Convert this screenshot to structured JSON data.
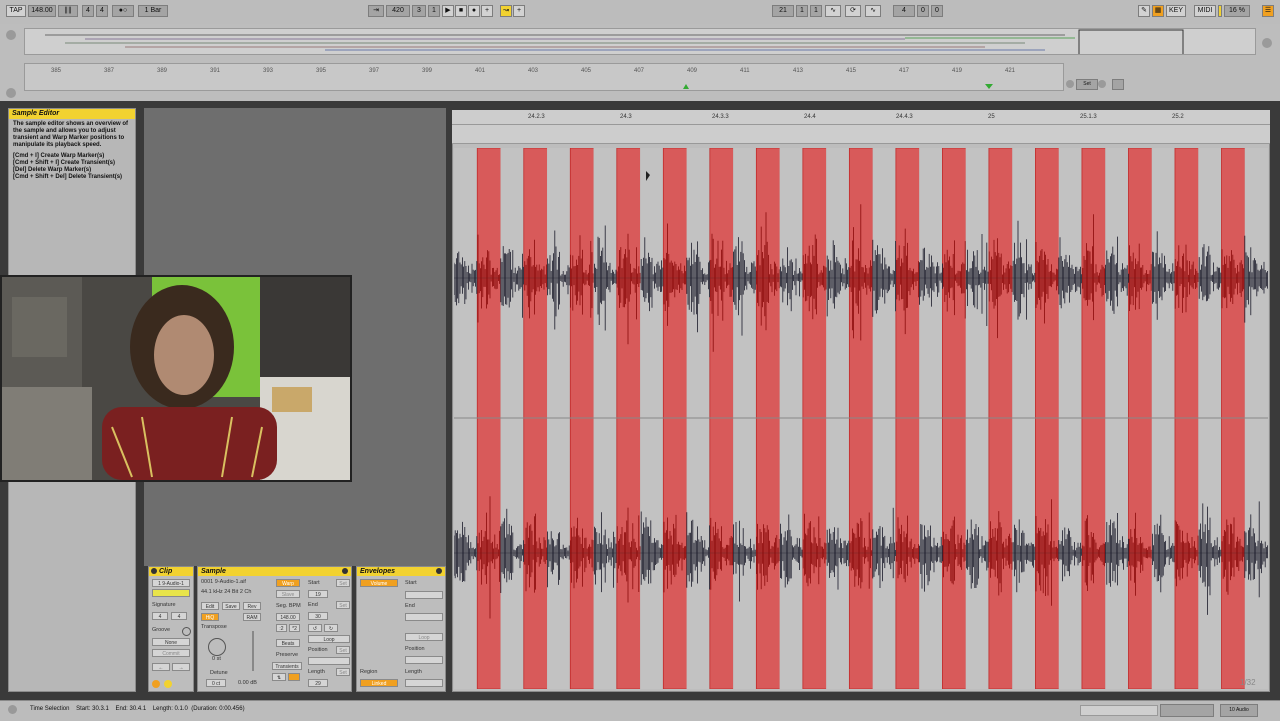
{
  "transport": {
    "tap": "TAP",
    "tempo": "148.00",
    "sig_num": "4",
    "sig_den": "4",
    "quantize": "1 Bar",
    "arr_pos_bar": "420",
    "arr_pos_beat": "3",
    "arr_pos_sixteenth": "1",
    "loop_start_bar": "21",
    "loop_start_beat": "1",
    "loop_start_sixteenth": "1",
    "loop_len_bar": "4",
    "loop_len_beat": "0",
    "loop_len_sixteenth": "0",
    "key": "KEY",
    "midi": "MIDI",
    "cpu": "16 %"
  },
  "arrangement_ruler": [
    "385",
    "387",
    "389",
    "391",
    "393",
    "395",
    "397",
    "399",
    "401",
    "403",
    "405",
    "407",
    "409",
    "411",
    "413",
    "415",
    "417",
    "419",
    "421"
  ],
  "info_view": {
    "title": "Sample Editor",
    "body": "The sample editor shows an overview of the sample and allows you to adjust transient and Warp Marker positions to manipulate its playback speed.",
    "shortcuts": [
      "[Cmd + I] Create Warp Marker(s)",
      "[Cmd + Shift + I] Create Transient(s)",
      "[Del] Delete Warp Marker(s)",
      "[Cmd + Shift + Del] Delete Transient(s)"
    ]
  },
  "clip_panel": {
    "clip_title": "Clip",
    "clip_name": "1 9-Audio-1",
    "signature_label": "Signature",
    "sig_num": "4",
    "sig_den": "4",
    "groove_label": "Groove",
    "groove_value": "None",
    "commit": "Commit"
  },
  "sample_panel": {
    "title": "Sample",
    "file": "0001 9-Audio-1.aif",
    "info": "44.1 kHz 24 Bit 2 Ch",
    "warp": "Warp",
    "edit": "Edit",
    "save": "Save",
    "rev": "Rev",
    "hiq": "HiQ",
    "ram": "RAM",
    "transpose_label": "Transpose",
    "transpose_value": "0 st",
    "detune_label": "Detune",
    "detune_value": "0 ct",
    "gain_value": "0.00 dB",
    "slave": "Slave",
    "seg_bpm_label": "Seg. BPM",
    "seg_bpm": "148.00",
    "half": ":2",
    "double": "*2",
    "beats": "Beats",
    "preserve_label": "Preserve",
    "preserve_value": "Transients",
    "start_label": "Start",
    "end_label": "End",
    "loop": "Loop",
    "position_label": "Position",
    "length_label": "Length",
    "set": "Set",
    "start_val": "19",
    "end_val": "30",
    "len_val": "29"
  },
  "envelopes_panel": {
    "title": "Envelopes",
    "device": "Volume",
    "start": "Start",
    "end": "End",
    "loop": "Loop",
    "position": "Position",
    "length": "Length",
    "region": "Region",
    "linked": "Linked"
  },
  "editor": {
    "ruler_labels": [
      "24.2.3",
      "24.3",
      "24.3.3",
      "24.4",
      "24.4.3",
      "25",
      "25.1.3",
      "25.2"
    ],
    "zoom": "1/32",
    "stripe_count": 35
  },
  "status": {
    "text": "Time Selection    Start: 30.3.1    End: 30.4.1    Length: 0.1.0  (Duration: 0:00.456)",
    "track": "10 Audio"
  },
  "colors": {
    "warp_red": "#d85a5a",
    "warp_grey": "#c2c2c2",
    "accent_yellow": "#f2d230",
    "accent_orange": "#f0a020"
  }
}
